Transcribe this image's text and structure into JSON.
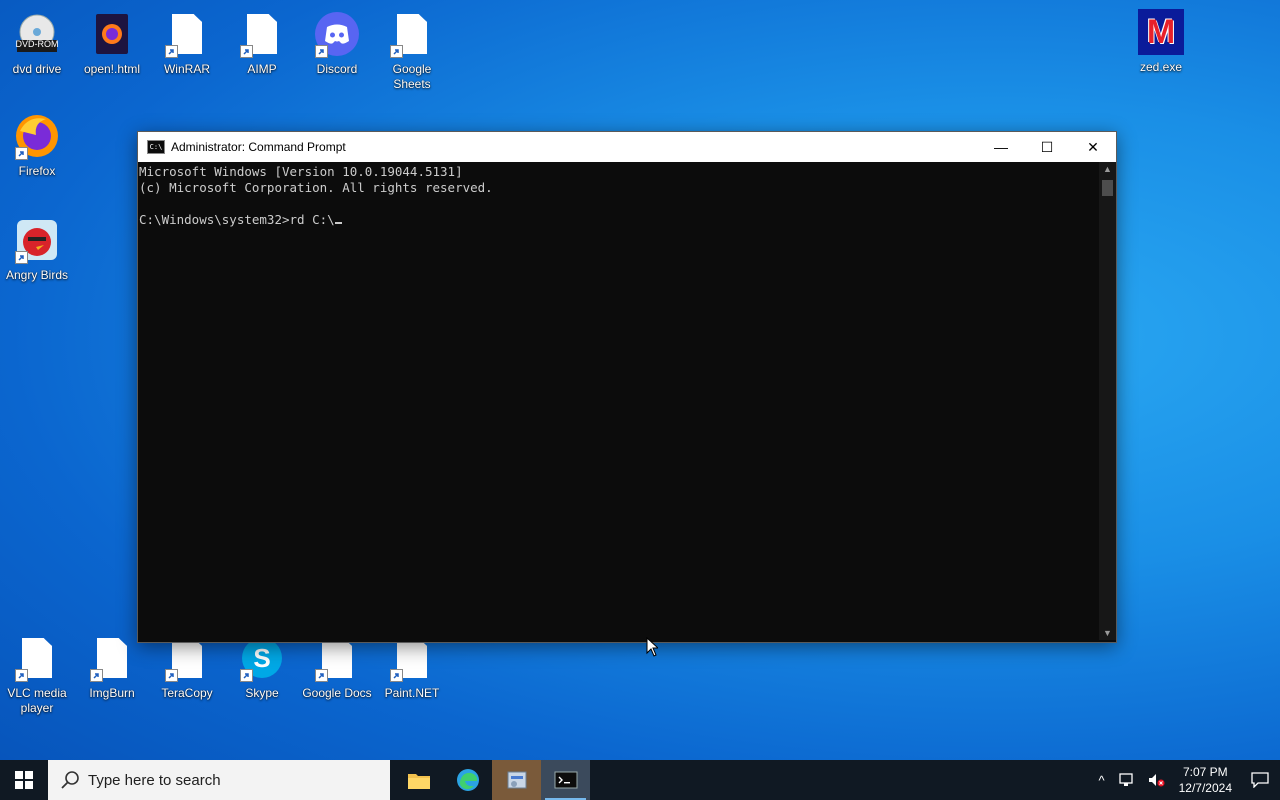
{
  "desktop": {
    "icons_top": [
      {
        "label": "dvd drive",
        "badge": "DVD-ROM"
      },
      {
        "label": "open!.html"
      },
      {
        "label": "WinRAR"
      },
      {
        "label": "AIMP"
      },
      {
        "label": "Discord"
      },
      {
        "label": "Google Sheets"
      }
    ],
    "icons_left": [
      {
        "label": "Firefox"
      },
      {
        "label": "Angry Birds"
      }
    ],
    "icons_bottom": [
      {
        "label": "VLC media player"
      },
      {
        "label": "ImgBurn"
      },
      {
        "label": "TeraCopy"
      },
      {
        "label": "Skype"
      },
      {
        "label": "Google Docs"
      },
      {
        "label": "Paint.NET"
      }
    ],
    "icon_right": {
      "label": "zed.exe",
      "glyph": "M"
    }
  },
  "cmd": {
    "title": "Administrator: Command Prompt",
    "title_icon_text": "C:\\",
    "lines": [
      "Microsoft Windows [Version 10.0.19044.5131]",
      "(c) Microsoft Corporation. All rights reserved.",
      "",
      "C:\\Windows\\system32>rd C:\\"
    ],
    "minimize": "—",
    "maximize": "☐",
    "close": "✕"
  },
  "taskbar": {
    "search_placeholder": "Type here to search",
    "time": "7:07 PM",
    "date": "12/7/2024",
    "tray_chevron": "^"
  },
  "colors": {
    "accent": "#0b66cf",
    "terminal_bg": "#0c0c0c",
    "terminal_fg": "#cccccc",
    "taskbar_bg": "#101923"
  }
}
